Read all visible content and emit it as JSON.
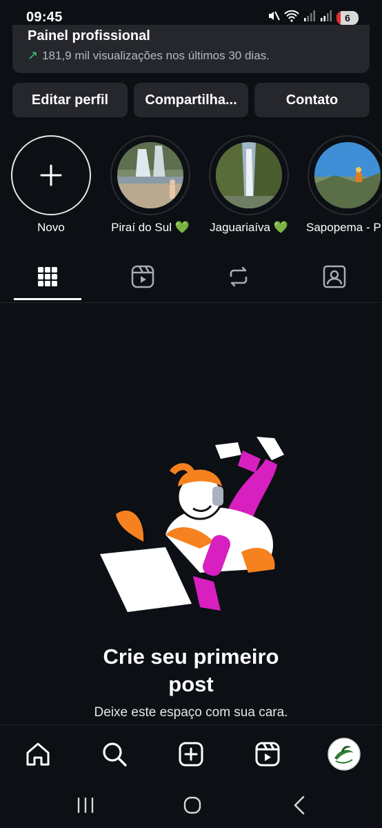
{
  "status_bar": {
    "time": "09:45",
    "battery": "6"
  },
  "pro_panel": {
    "title": "Painel profissional",
    "stats": "181,9 mil visualizações nos últimos 30 dias."
  },
  "buttons": {
    "edit": "Editar perfil",
    "share": "Compartilha...",
    "contact": "Contato"
  },
  "highlights": {
    "new": "Novo",
    "items": [
      {
        "label": "Piraí do Sul 💚"
      },
      {
        "label": "Jaguariaíva 💚"
      },
      {
        "label": "Sapopema - P"
      }
    ]
  },
  "tabs": [
    "grid-icon",
    "reels-icon",
    "reposts-icon",
    "tagged-icon"
  ],
  "empty_state": {
    "title_line1": "Crie seu primeiro",
    "title_line2": "post",
    "subtitle": "Deixe este espaço com sua cara."
  },
  "bottom_nav": [
    "home-icon",
    "search-icon",
    "create-icon",
    "reels-icon",
    "profile-avatar"
  ],
  "colors": {
    "background": "#0c0f14",
    "panel": "#25272c",
    "accent_orange": "#f5821f",
    "accent_magenta": "#d81fbf",
    "trend_green": "#2ecc71"
  }
}
